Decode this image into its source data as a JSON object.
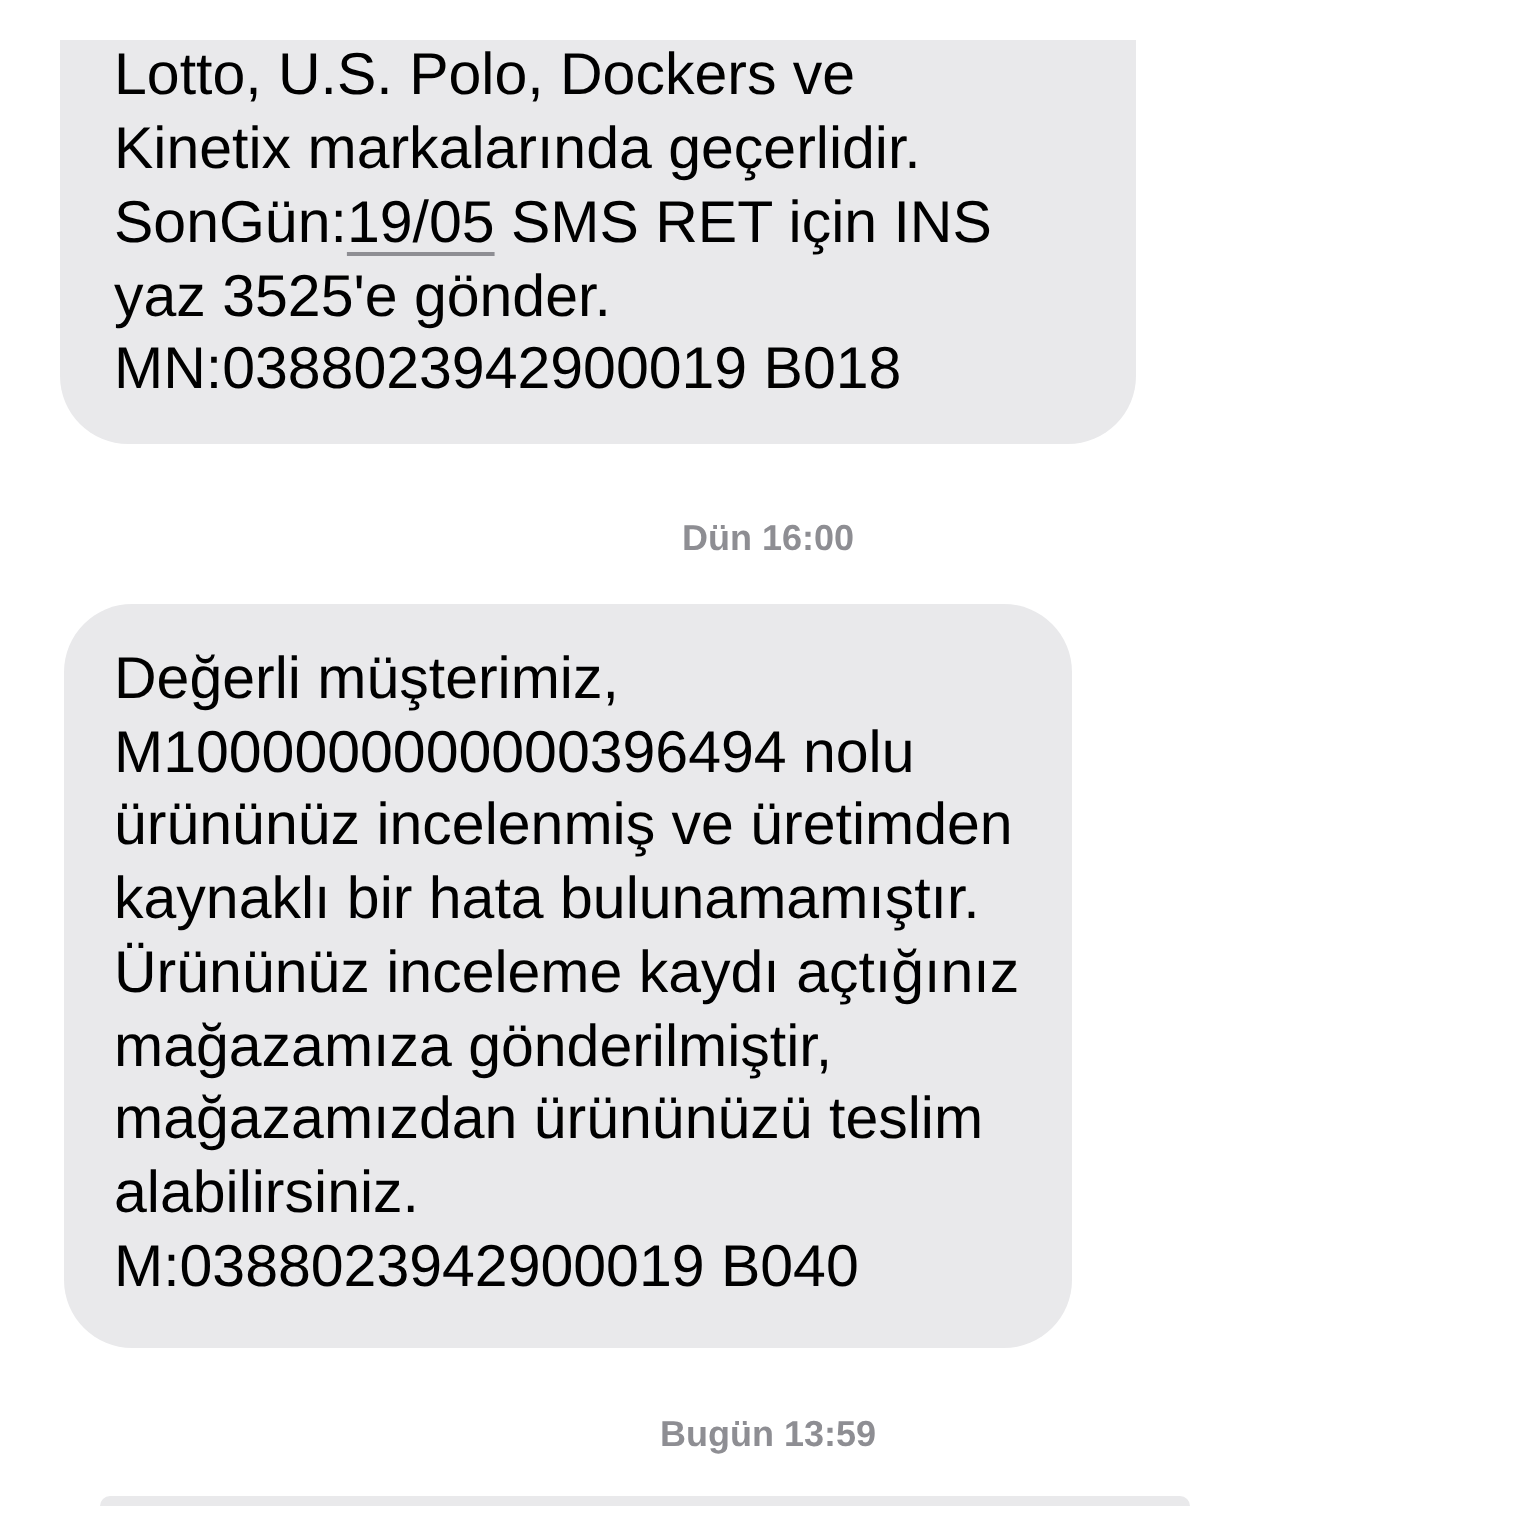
{
  "messages": [
    {
      "kind": "cut_bubble",
      "text_before": "Lotto, U.S. Polo, Dockers ve\nKinetix markalarında geçerlidir.\nSonGün:",
      "date_link": "19/05",
      "text_after": " SMS RET için INS\nyaz 3525'e gönder.\nMN:0388023942900019 B018"
    },
    {
      "kind": "timestamp",
      "text": "Dün 16:00"
    },
    {
      "kind": "bubble",
      "text": "Değerli müşterimiz,\nM1000000000000396494 nolu\nürününüz incelenmiş ve üretimden\nkaynaklı bir hata bulunamamıştır.\nÜrününüz inceleme kaydı açtığınız\nmağazamıza gönderilmiştir,\nmağazamızdan ürününüzü teslim\nalabilirsiniz.\nM:0388023942900019 B040"
    },
    {
      "kind": "timestamp",
      "text": "Bugün 13:59"
    },
    {
      "kind": "bubble_edge"
    }
  ]
}
